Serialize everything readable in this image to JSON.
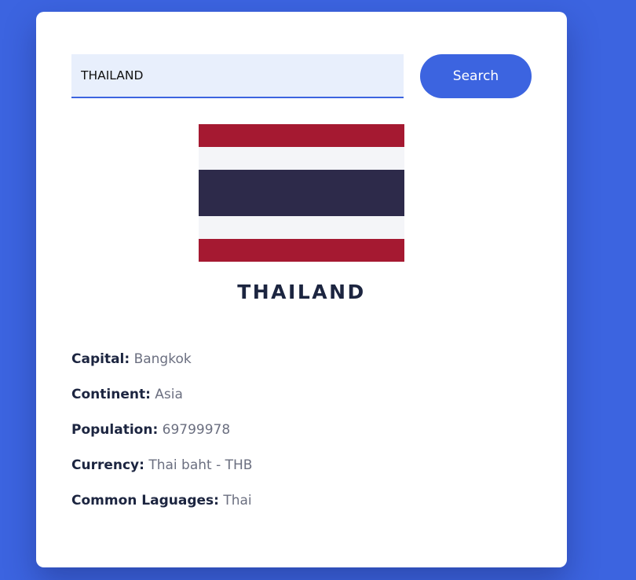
{
  "search": {
    "value": "THAILAND",
    "placeholder": "",
    "button_label": "Search"
  },
  "flag": {
    "icon": "thailand-flag-icon",
    "stripes": [
      "#a51931",
      "#f4f5f8",
      "#2d2a4a",
      "#f4f5f8",
      "#a51931"
    ],
    "ratios": [
      1,
      1,
      2,
      1,
      1
    ]
  },
  "country": {
    "name": "THAILAND"
  },
  "details": [
    {
      "label": "Capital:",
      "value": "Bangkok"
    },
    {
      "label": "Continent:",
      "value": "Asia"
    },
    {
      "label": "Population:",
      "value": "69799978"
    },
    {
      "label": "Currency:",
      "value": "Thai baht - THB"
    },
    {
      "label": "Common Laguages:",
      "value": "Thai"
    }
  ],
  "colors": {
    "background": "#3c64e0",
    "accent": "#3c64e0",
    "card": "#ffffff",
    "heading": "#1c2540",
    "muted": "#6b6f80"
  }
}
